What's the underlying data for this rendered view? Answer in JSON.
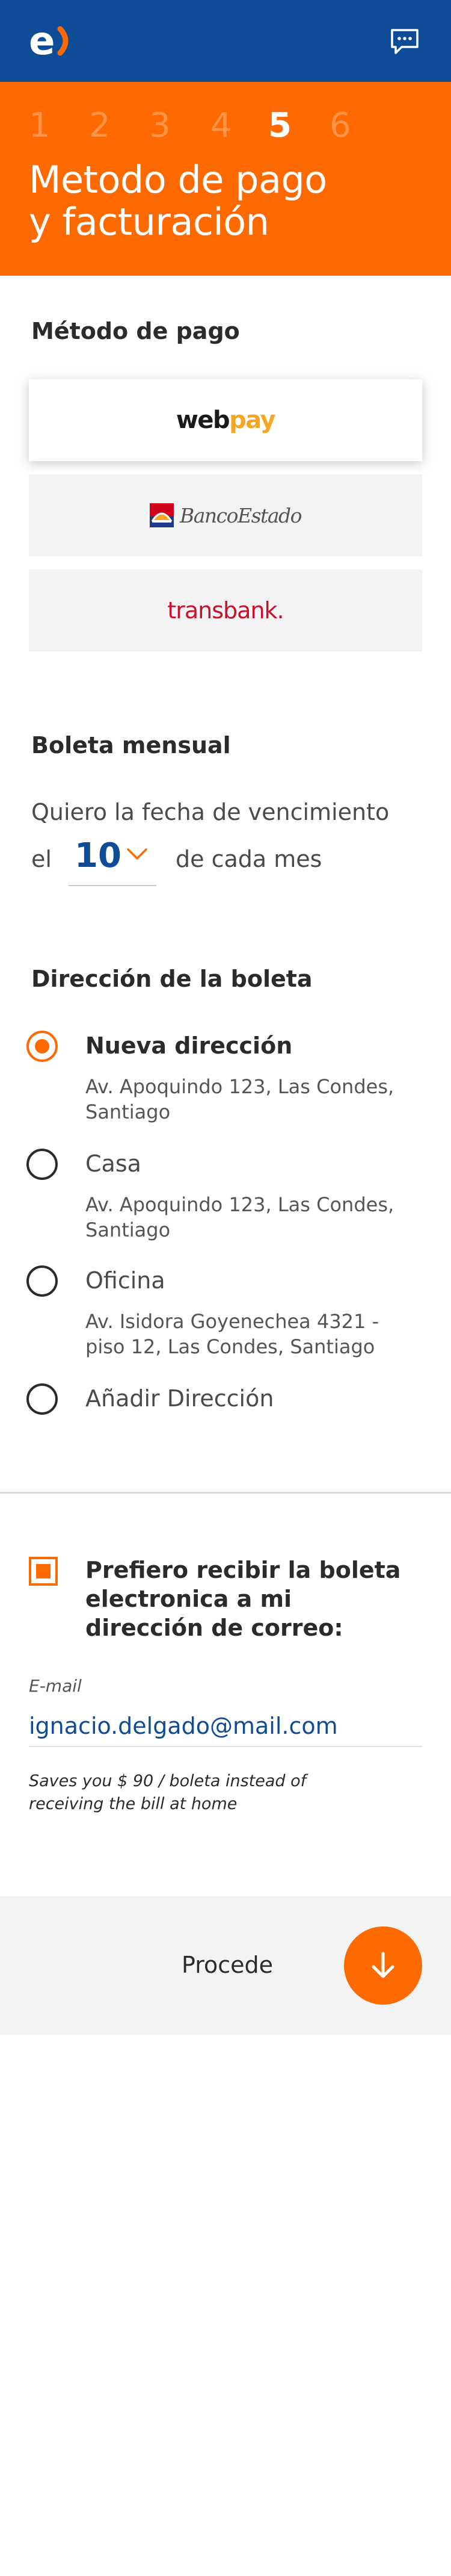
{
  "header": {
    "logo_icon": "entel-logo-icon",
    "chat_icon": "chat-bubble-icon",
    "brand_color": "#0f4c97"
  },
  "hero": {
    "steps": [
      "1",
      "2",
      "3",
      "4",
      "5",
      "6"
    ],
    "active_step": "5",
    "title_line1": "Metodo de pago",
    "title_line2": "y facturación",
    "accent_color": "#ff6a00"
  },
  "payment": {
    "section_title": "Método de pago",
    "methods": [
      {
        "name_part1": "web",
        "name_part2": "pay",
        "selected": true
      },
      {
        "name": "BancoEstado",
        "selected": false
      },
      {
        "name": "transbank.",
        "selected": false
      }
    ]
  },
  "billing": {
    "section_title": "Boleta mensual",
    "due_text": "Quiero la fecha de vencimiento",
    "prefix": "el",
    "day": "10",
    "suffix": "de cada mes"
  },
  "address": {
    "section_title": "Dirección de la boleta",
    "options": [
      {
        "label": "Nueva dirección",
        "detail": "Av. Apoquindo 123, Las Condes, Santiago",
        "checked": true
      },
      {
        "label": "Casa",
        "detail": "Av. Apoquindo 123, Las Condes, Santiago",
        "checked": false
      },
      {
        "label": "Oficina",
        "detail": "Av. Isidora Goyenechea 4321 - piso 12, Las Condes, Santiago",
        "checked": false
      },
      {
        "label": "Añadir Dirección",
        "detail": "",
        "checked": false
      }
    ]
  },
  "electronic": {
    "checkbox_label": "Prefiero recibir la boleta electronica a mi dirección de correo:",
    "checked": true,
    "email_label": "E-mail",
    "email_value": "ignacio.delgado@mail.com",
    "helper": "Saves you $ 90 / boleta instead of receiving the bill at home"
  },
  "footer": {
    "proceed_label": "Procede",
    "proceed_icon": "arrow-down-icon"
  }
}
